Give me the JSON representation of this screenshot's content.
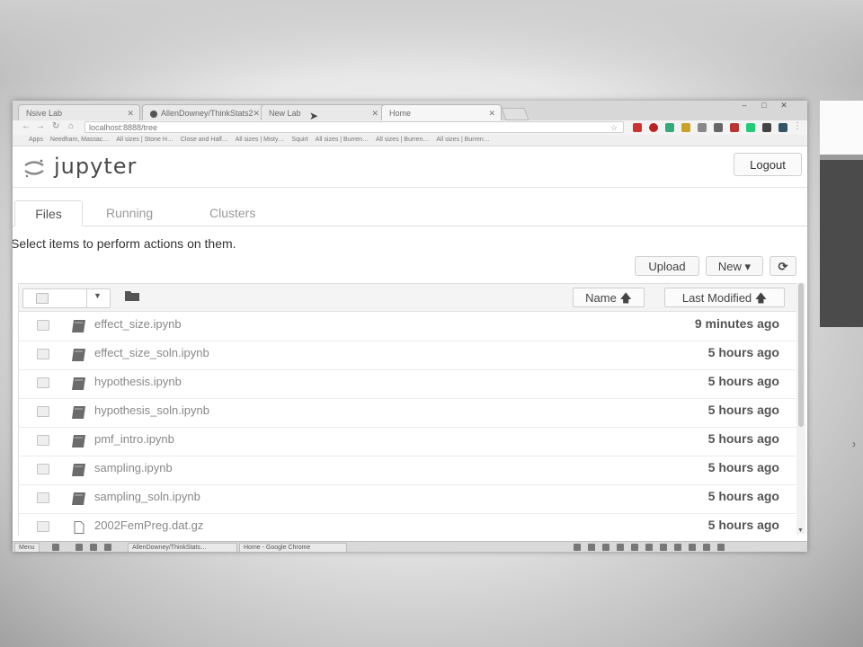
{
  "browser": {
    "tabs": [
      {
        "label": "Nsive Lab"
      },
      {
        "label": "AllenDowney/ThinkStats2"
      },
      {
        "label": "New Lab"
      },
      {
        "label": "Home"
      }
    ],
    "address": "localhost:8888/tree",
    "bookmarks": [
      "Apps",
      "Needham, Massac…",
      "All sizes | Stone H…",
      "Close and Half…",
      "All sizes | Misty…",
      "Squirt",
      "All sizes | Burren…",
      "All sizes | Burren…",
      "All sizes | Burren…"
    ]
  },
  "header": {
    "logo_text": "jupyter",
    "logout_label": "Logout"
  },
  "nav_tabs": [
    {
      "label": "Files"
    },
    {
      "label": "Running"
    },
    {
      "label": "Clusters"
    }
  ],
  "instructions": "Select items to perform actions on them.",
  "toolbar": {
    "upload_label": "Upload",
    "new_label": "New ▾",
    "refresh_icon": "refresh-icon"
  },
  "list_header": {
    "name_sort_label": "Name 🡅",
    "last_modified_label": "Last Modified 🡅"
  },
  "files": [
    {
      "name": "effect_size.ipynb",
      "modified": "9 minutes ago",
      "type": "notebook"
    },
    {
      "name": "effect_size_soln.ipynb",
      "modified": "5 hours ago",
      "type": "notebook"
    },
    {
      "name": "hypothesis.ipynb",
      "modified": "5 hours ago",
      "type": "notebook"
    },
    {
      "name": "hypothesis_soln.ipynb",
      "modified": "5 hours ago",
      "type": "notebook"
    },
    {
      "name": "pmf_intro.ipynb",
      "modified": "5 hours ago",
      "type": "notebook"
    },
    {
      "name": "sampling.ipynb",
      "modified": "5 hours ago",
      "type": "notebook"
    },
    {
      "name": "sampling_soln.ipynb",
      "modified": "5 hours ago",
      "type": "notebook"
    },
    {
      "name": "2002FemPreg.dat.gz",
      "modified": "5 hours ago",
      "type": "file"
    }
  ],
  "taskbar": {
    "menu_label": "Menu",
    "items": [
      "AllenDowney/ThinkStats…",
      "Home - Google Chrome"
    ]
  },
  "colors": {
    "jupyter_orange": "#f37726",
    "notebook_icon": "#6b6b6b",
    "text_muted": "#888888"
  }
}
